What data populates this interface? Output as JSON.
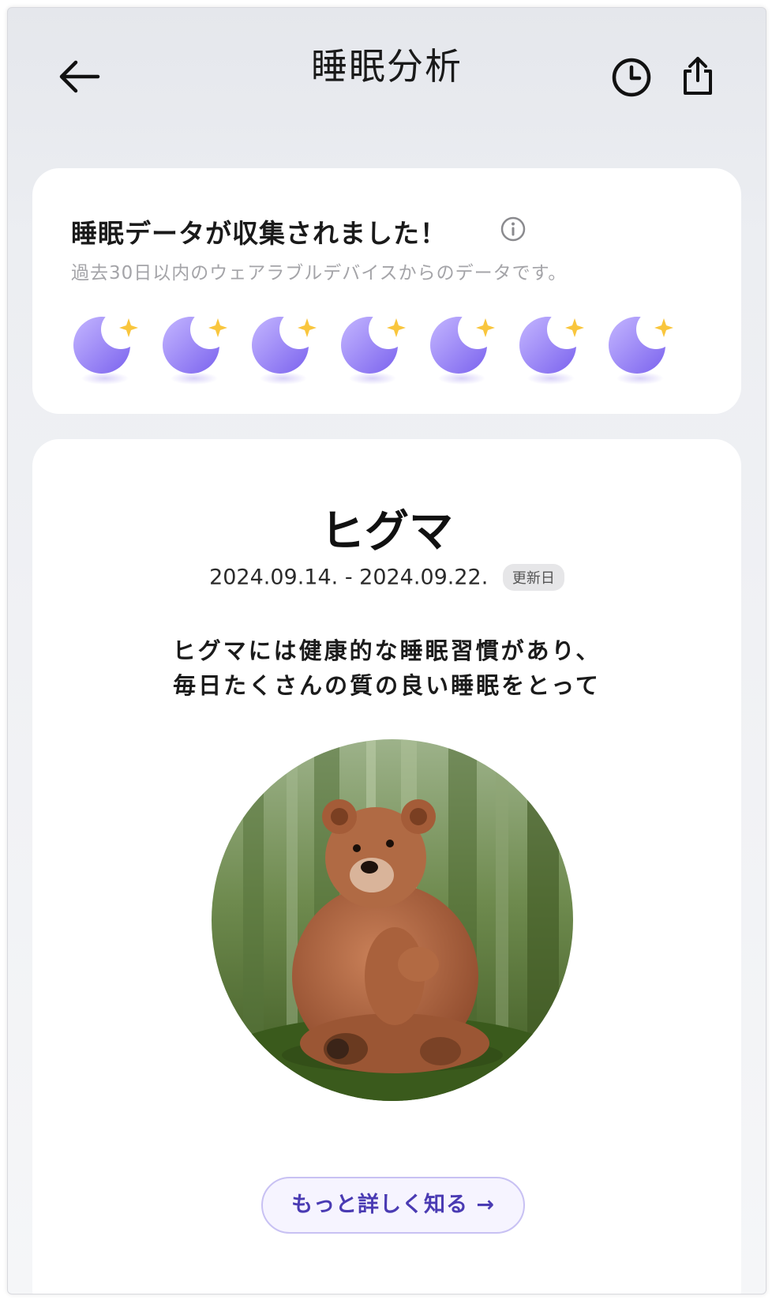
{
  "header": {
    "title": "睡眠分析",
    "back_icon": "arrow-left-icon",
    "history_icon": "clock-icon",
    "share_icon": "share-icon"
  },
  "collection": {
    "title": "睡眠データが収集されました！",
    "subtitle": "過去30日以内のウェアラブルデバイスからのデータです。",
    "moon_count": 7,
    "moon_color": "#8f7cf2",
    "star_color": "#f9c63d"
  },
  "result": {
    "name": "ヒグマ",
    "date_range": "2024.09.14. - 2024.09.22.",
    "badge": "更新日",
    "description_line1": "ヒグマには健康的な睡眠習慣があり、",
    "description_line2": "毎日たくさんの質の良い睡眠をとって",
    "image_subject": "brown-bear-illustration",
    "more_button": "もっと詳しく知る →"
  },
  "colors": {
    "accent": "#4a3bb3",
    "button_border": "#c8c1f3",
    "button_bg": "#f6f4ff"
  }
}
